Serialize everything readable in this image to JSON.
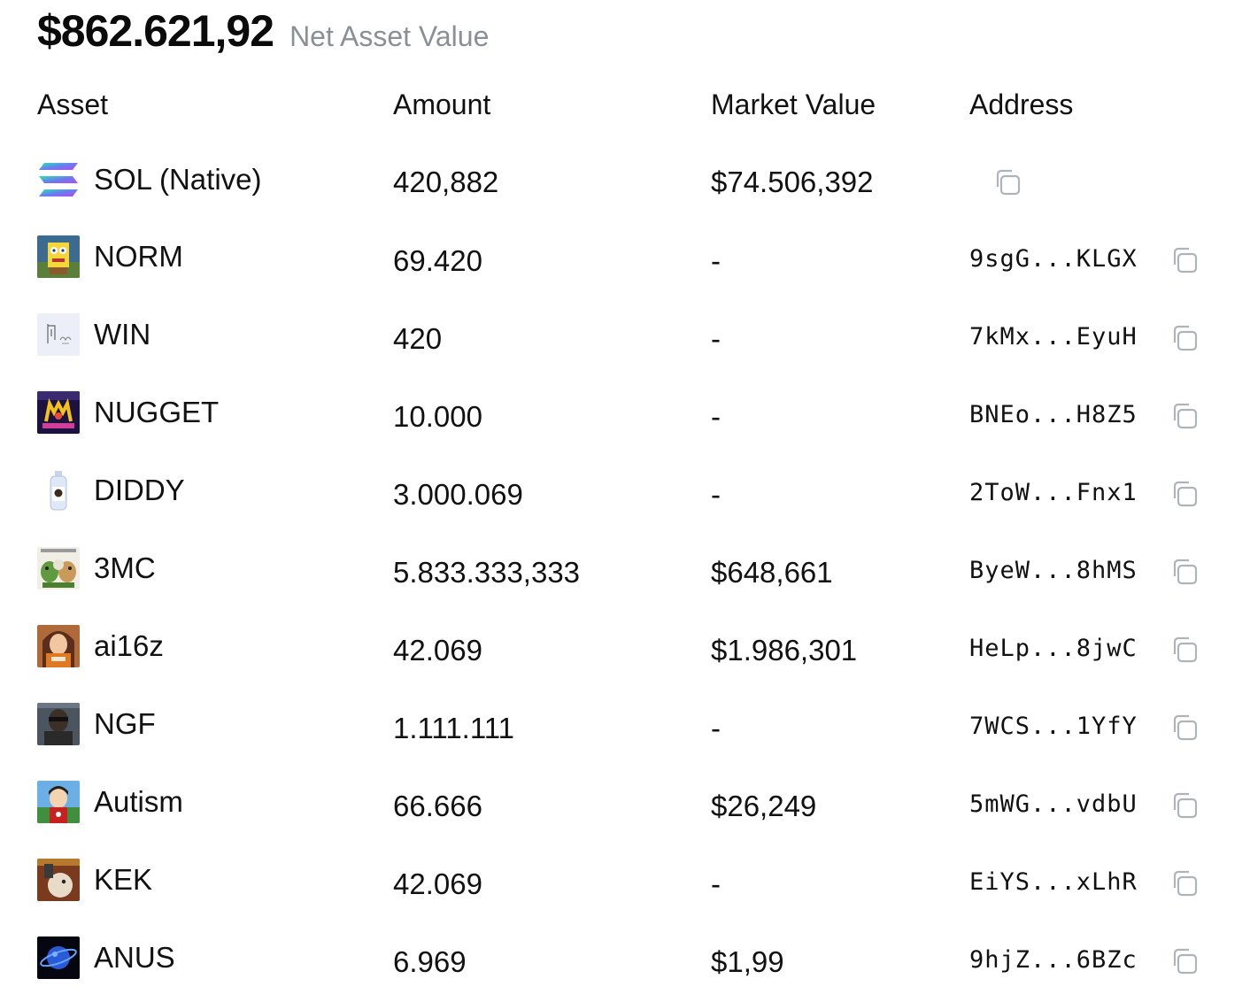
{
  "header": {
    "net_asset_value": "$862.621,92",
    "net_asset_label": "Net Asset Value"
  },
  "columns": {
    "asset": "Asset",
    "amount": "Amount",
    "market_value": "Market Value",
    "address": "Address"
  },
  "rows": [
    {
      "name": "SOL (Native)",
      "icon": "solana-logo-icon",
      "amount": "420,882",
      "market_value": "$74.506,392",
      "address": ""
    },
    {
      "name": "NORM",
      "icon": "norm-token-icon",
      "amount": "69.420",
      "market_value": "-",
      "address": "9sgG...KLGX"
    },
    {
      "name": "WIN",
      "icon": "win-token-icon",
      "amount": "420",
      "market_value": "-",
      "address": "7kMx...EyuH"
    },
    {
      "name": "NUGGET",
      "icon": "nugget-token-icon",
      "amount": "10.000",
      "market_value": "-",
      "address": "BNEo...H8Z5"
    },
    {
      "name": "DIDDY",
      "icon": "diddy-token-icon",
      "amount": "3.000.069",
      "market_value": "-",
      "address": "2ToW...Fnx1"
    },
    {
      "name": "3MC",
      "icon": "3mc-token-icon",
      "amount": "5.833.333,333",
      "market_value": "$648,661",
      "address": "ByeW...8hMS"
    },
    {
      "name": "ai16z",
      "icon": "ai16z-token-icon",
      "amount": "42.069",
      "market_value": "$1.986,301",
      "address": "HeLp...8jwC"
    },
    {
      "name": "NGF",
      "icon": "ngf-token-icon",
      "amount": "1.111.111",
      "market_value": "-",
      "address": "7WCS...1YfY"
    },
    {
      "name": "Autism",
      "icon": "autism-token-icon",
      "amount": "66.666",
      "market_value": "$26,249",
      "address": "5mWG...vdbU"
    },
    {
      "name": "KEK",
      "icon": "kek-token-icon",
      "amount": "42.069",
      "market_value": "-",
      "address": "EiYS...xLhR"
    },
    {
      "name": "ANUS",
      "icon": "anus-token-icon",
      "amount": "6.969",
      "market_value": "$1,99",
      "address": "9hjZ...6BZc"
    }
  ]
}
